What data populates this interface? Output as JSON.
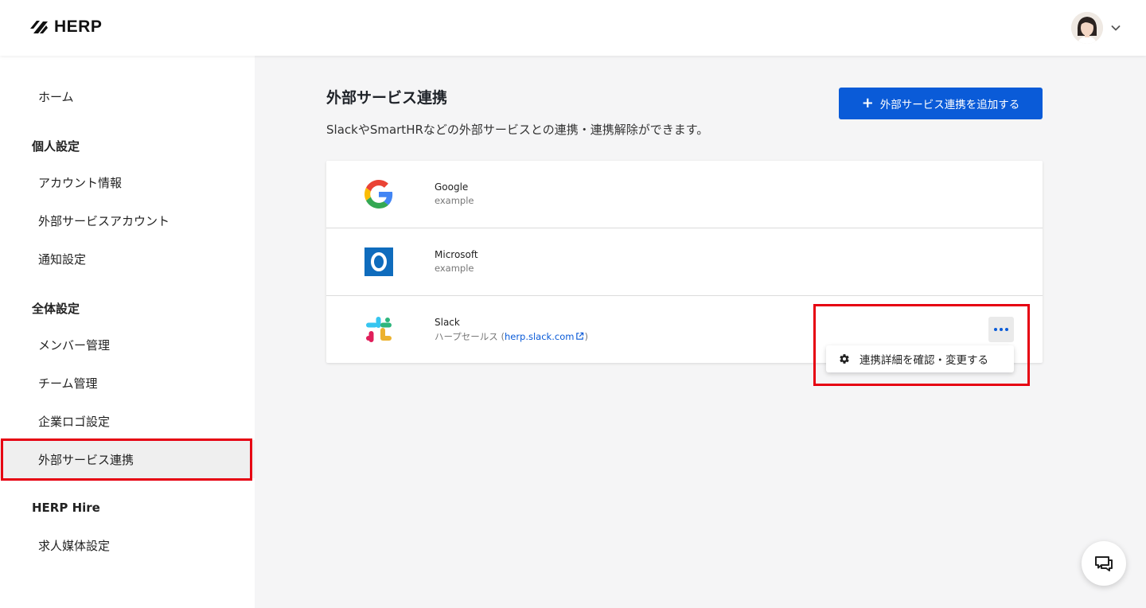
{
  "brand": {
    "name": "HERP"
  },
  "sidebar": {
    "home": "ホーム",
    "personal_heading": "個人設定",
    "personal_items": [
      "アカウント情報",
      "外部サービスアカウント",
      "通知設定"
    ],
    "global_heading": "全体設定",
    "global_items": [
      "メンバー管理",
      "チーム管理",
      "企業ロゴ設定",
      "外部サービス連携"
    ],
    "hire_heading": "HERP Hire",
    "hire_items": [
      "求人媒体設定"
    ],
    "active_item": "外部サービス連携"
  },
  "main": {
    "title": "外部サービス連携",
    "description": "SlackやSmartHRなどの外部サービスとの連携・連携解除ができます。",
    "add_button_label": "外部サービス連携を追加する",
    "services": [
      {
        "name": "Google",
        "account": "example",
        "icon": "google-logo-icon"
      },
      {
        "name": "Microsoft",
        "account": "example",
        "icon": "outlook-logo-icon"
      },
      {
        "name": "Slack",
        "account_prefix": "ハープセールス (",
        "account_link": "herp.slack.com",
        "account_suffix": ")",
        "icon": "slack-logo-icon"
      }
    ],
    "dropdown_item": "連携詳細を確認・変更する"
  },
  "colors": {
    "primary": "#0a5bd8",
    "highlight": "#e60012",
    "sidebar_active": "#efefef",
    "background": "#f5f5f6"
  }
}
